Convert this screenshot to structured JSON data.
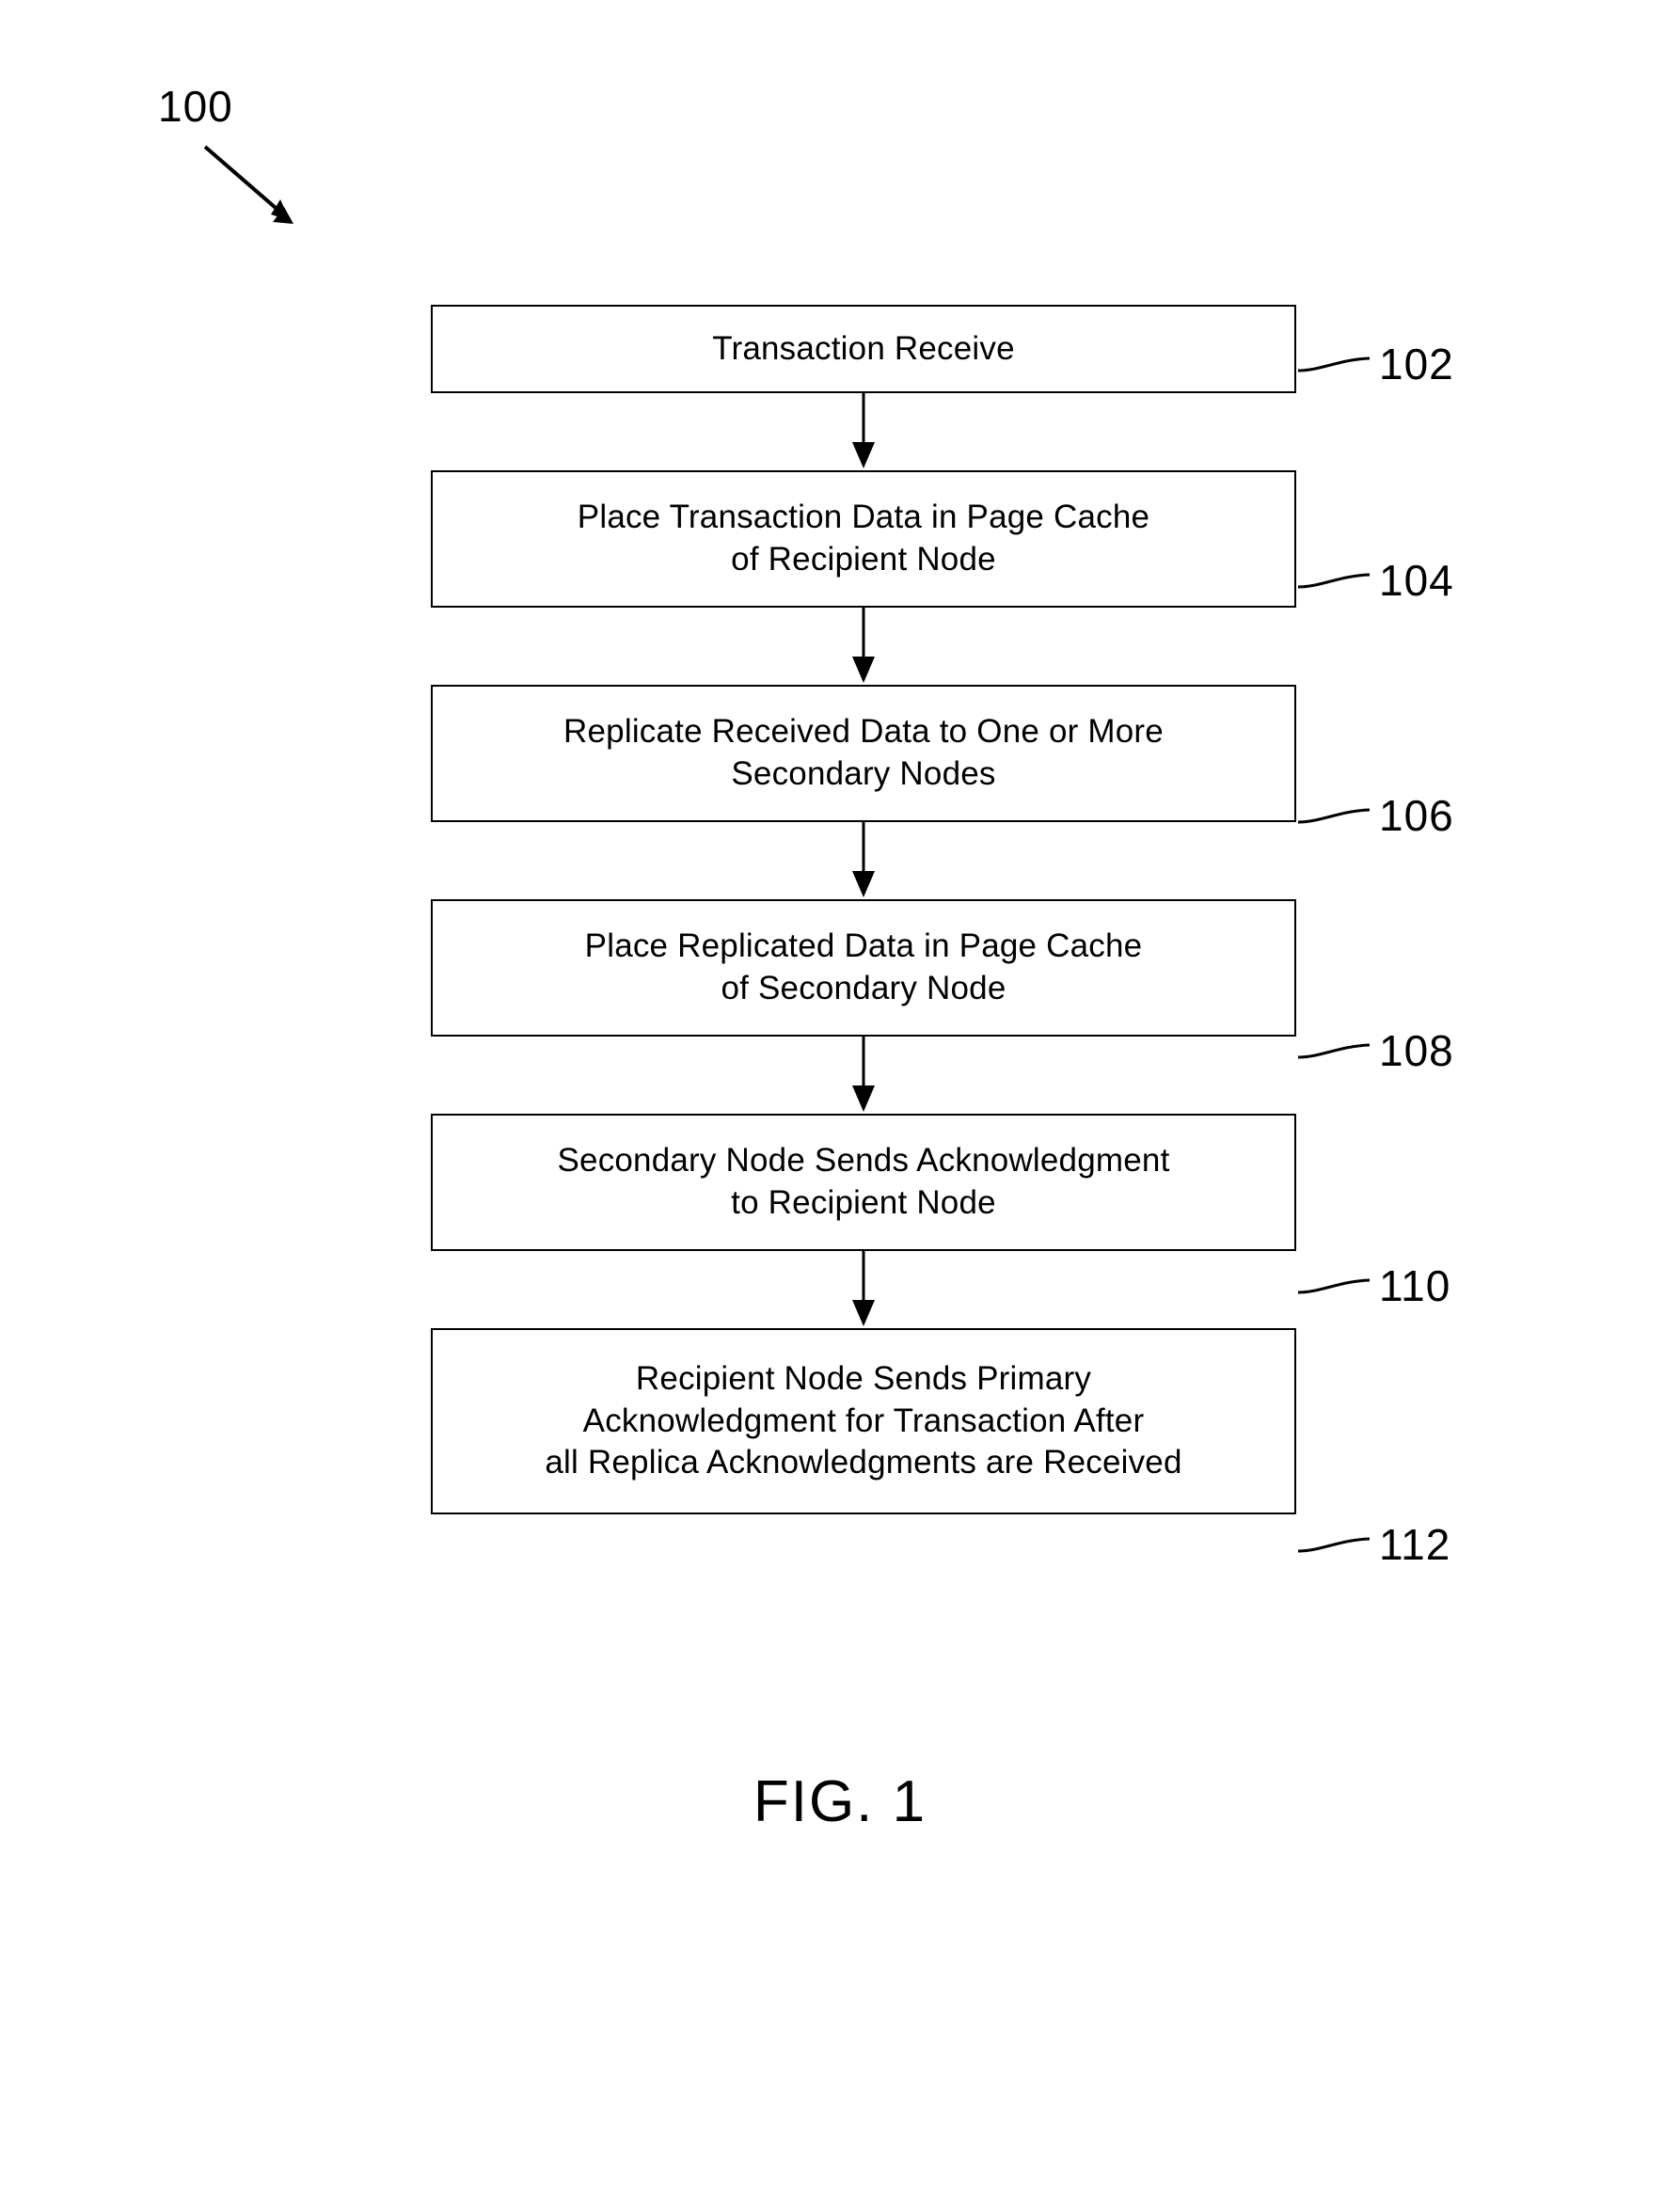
{
  "figure": {
    "figure_number_label": "100",
    "caption": "FIG. 1"
  },
  "flowchart": {
    "type": "flowchart",
    "orientation": "vertical",
    "steps": [
      {
        "ref": "102",
        "text": "Transaction Receive",
        "lines": [
          "Transaction Receive"
        ]
      },
      {
        "ref": "104",
        "text": "Place Transaction Data in Page Cache\nof Recipient Node",
        "lines": [
          "Place Transaction Data in Page Cache",
          "of Recipient Node"
        ]
      },
      {
        "ref": "106",
        "text": "Replicate Received Data to One or More\nSecondary Nodes",
        "lines": [
          "Replicate Received Data to One or More",
          "Secondary Nodes"
        ]
      },
      {
        "ref": "108",
        "text": "Place Replicated Data in Page Cache\nof Secondary Node",
        "lines": [
          "Place Replicated Data in Page Cache",
          "of Secondary Node"
        ]
      },
      {
        "ref": "110",
        "text": "Secondary Node Sends Acknowledgment\nto Recipient Node",
        "lines": [
          "Secondary Node Sends Acknowledgment",
          "to Recipient Node"
        ]
      },
      {
        "ref": "112",
        "text": "Recipient Node Sends Primary\nAcknowledgment for Transaction After\nall Replica Acknowledgments are Received",
        "lines": [
          "Recipient Node Sends Primary",
          "Acknowledgment for Transaction After",
          "all Replica Acknowledgments are Received"
        ]
      }
    ],
    "connector_count": 5,
    "connector_style": "solid line with filled triangular arrowhead pointing down"
  },
  "colors": {
    "line": "#000000",
    "background": "#ffffff",
    "text": "#000000"
  }
}
